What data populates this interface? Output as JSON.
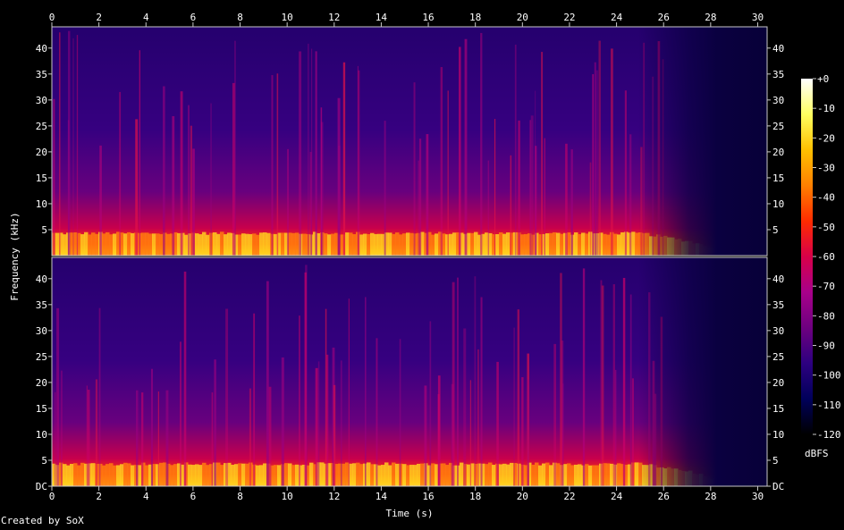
{
  "chart_data": {
    "type": "heatmap",
    "xlabel": "Time (s)",
    "ylabel": "Frequency (kHz)",
    "x_ticks": [
      "0",
      "2",
      "4",
      "6",
      "8",
      "10",
      "12",
      "14",
      "16",
      "18",
      "20",
      "22",
      "24",
      "26",
      "28",
      "30"
    ],
    "y_ticks": [
      "DC",
      "5",
      "10",
      "15",
      "20",
      "25",
      "30",
      "35",
      "40"
    ],
    "xlim": [
      0,
      30.4
    ],
    "ylim_khz": [
      0,
      44.1
    ],
    "channels": 2,
    "colorbar": {
      "label": "dBFS",
      "ticks": [
        "+0",
        "-10",
        "-20",
        "-30",
        "-40",
        "-50",
        "-60",
        "-70",
        "-80",
        "-90",
        "-100",
        "-110",
        "-120"
      ],
      "range": [
        -120,
        0
      ],
      "colors": [
        "#000000",
        "#00005a",
        "#2d0080",
        "#6e0080",
        "#a8008a",
        "#d80048",
        "#ff2c00",
        "#ff8000",
        "#ffc000",
        "#ffff60",
        "#ffffff"
      ]
    },
    "energy_profile": {
      "description_times_s": [
        0,
        25,
        27,
        28.5,
        30.4
      ],
      "bright_band_top_khz": [
        4,
        4,
        2.5,
        0.5,
        0
      ],
      "quiet_after_s": 26
    }
  },
  "footer": "Created by SoX"
}
